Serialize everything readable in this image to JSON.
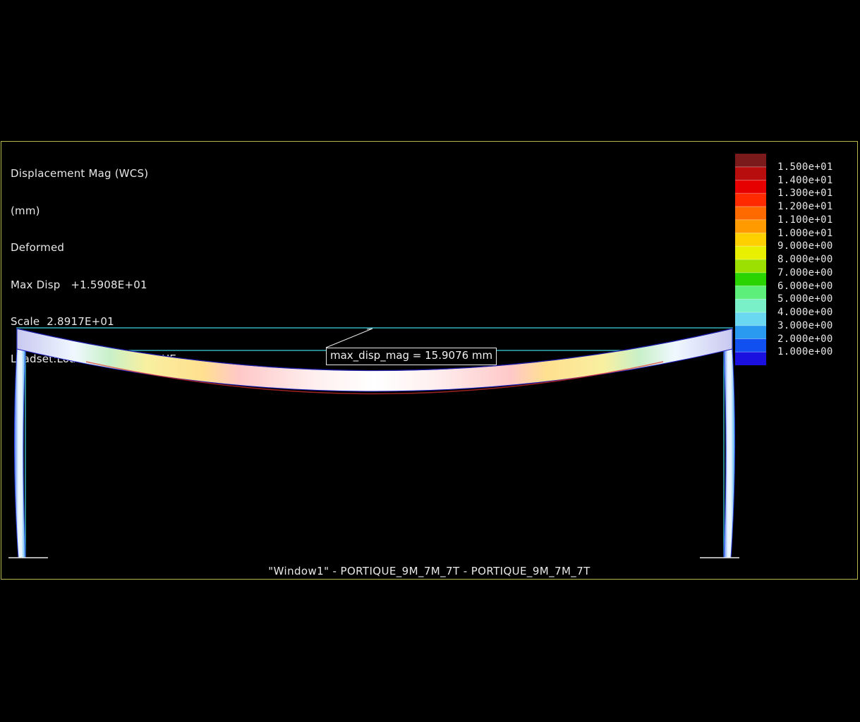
{
  "header": {
    "quantity": "Displacement Mag (WCS)",
    "units": "(mm)",
    "state": "Deformed",
    "max_disp": "Max Disp   +1.5908E+01",
    "scale": "Scale  2.8917E+01",
    "loadset": "Loadset:LoadSet1 :  PORTIQUE"
  },
  "legend": {
    "labels": [
      "1.500e+01",
      "1.400e+01",
      "1.300e+01",
      "1.200e+01",
      "1.100e+01",
      "1.000e+01",
      "9.000e+00",
      "8.000e+00",
      "7.000e+00",
      "6.000e+00",
      "5.000e+00",
      "4.000e+00",
      "3.000e+00",
      "2.000e+00",
      "1.000e+00"
    ],
    "colors": [
      "#7a1a1a",
      "#b80d0d",
      "#e60000",
      "#ff2a00",
      "#ff6a00",
      "#ff9a00",
      "#ffd000",
      "#e8f000",
      "#9be000",
      "#2ad400",
      "#5cf07a",
      "#7af0c8",
      "#6ad8f0",
      "#2a9af0",
      "#1050f0",
      "#1a10e0"
    ]
  },
  "annotation": {
    "text": "max_disp_mag = 15.9076  mm"
  },
  "footer": {
    "window": "\"Window1\" - PORTIQUE_9M_7M_7T - PORTIQUE_9M_7M_7T"
  },
  "colors": {
    "frame_border": "#b8b84a",
    "undeformed": "#3cc8d8",
    "background": "#000000"
  }
}
